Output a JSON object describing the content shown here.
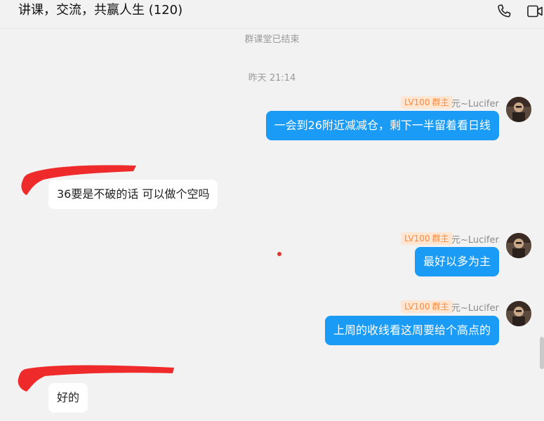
{
  "header": {
    "title": "讲课，交流，共赢人生 (120)",
    "icons": [
      "phone-icon",
      "video-call-icon"
    ]
  },
  "system": {
    "class_ended": "群课堂已结束",
    "timestamp": "昨天 21:14"
  },
  "messages": [
    {
      "direction": "out",
      "badge_level": "LV100",
      "badge_role": "群主",
      "sender": "元~Lucifer",
      "text": "一会到26附近减减仓，剩下一半留着看日线"
    },
    {
      "direction": "in",
      "text": "36要是不破的话 可以做个空吗"
    },
    {
      "direction": "out",
      "badge_level": "LV100",
      "badge_role": "群主",
      "sender": "元~Lucifer",
      "text": "最好以多为主"
    },
    {
      "direction": "out",
      "badge_level": "LV100",
      "badge_role": "群主",
      "sender": "元~Lucifer",
      "text": "上周的收线看这周要给个高点的"
    },
    {
      "direction": "in",
      "text": "好的"
    }
  ],
  "colors": {
    "outgoing_bubble": "#1a9bf5",
    "incoming_bubble": "#ffffff",
    "badge_bg": "#ffe6d2",
    "badge_text": "#ff8a3d",
    "redaction": "#ee2a2a"
  }
}
